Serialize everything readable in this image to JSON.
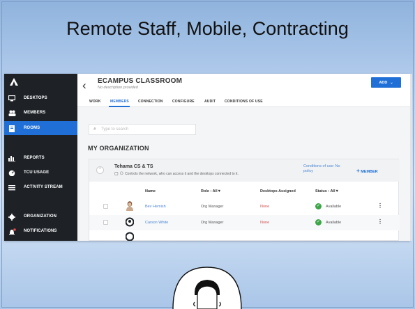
{
  "slide": {
    "title": "Remote Staff, Mobile, Contracting"
  },
  "sidebar": {
    "items": [
      {
        "label": "DESKTOPS",
        "icon": "monitor-icon"
      },
      {
        "label": "MEMBERS",
        "icon": "people-icon"
      },
      {
        "label": "ROOMS",
        "icon": "book-icon",
        "active": true
      },
      {
        "label": "REPORTS",
        "icon": "bar-chart-icon"
      },
      {
        "label": "TCU USAGE",
        "icon": "gauge-icon"
      },
      {
        "label": "ACTIVITY STREAM",
        "icon": "list-icon"
      },
      {
        "label": "ORGANIZATION",
        "icon": "gear-icon"
      },
      {
        "label": "NOTIFICATIONS",
        "icon": "bell-icon"
      }
    ]
  },
  "header": {
    "title": "ECAMPUS CLASSROOM",
    "subtitle": "No description provided",
    "add_label": "ADD"
  },
  "tabs": [
    {
      "label": "WORK"
    },
    {
      "label": "MEMBERS",
      "active": true
    },
    {
      "label": "CONNECTION"
    },
    {
      "label": "CONFIGURE"
    },
    {
      "label": "AUDIT"
    },
    {
      "label": "CONDITIONS OF USE"
    }
  ],
  "search": {
    "placeholder": "Type to search"
  },
  "org": {
    "title": "MY ORGANIZATION"
  },
  "team": {
    "name": "Tehama CS & TS",
    "description": "Controls the network, who can access it and the desktops connected to it.",
    "conditions": "Conditions of use: No policy",
    "add_member": "MEMBER"
  },
  "table": {
    "headers": {
      "name": "Name",
      "role": "Role : All",
      "desktops": "Desktops Assigned",
      "status": "Status : All"
    },
    "rows": [
      {
        "name": "Bev Hemish",
        "role": "Org Manager",
        "desktops": "None",
        "status": "Available"
      },
      {
        "name": "Carson White",
        "role": "Org Manager",
        "desktops": "None",
        "status": "Available"
      }
    ]
  },
  "colors": {
    "accent": "#1f6fd6",
    "sidebar": "#1e2227",
    "available": "#3ca648",
    "none": "#d05050"
  }
}
